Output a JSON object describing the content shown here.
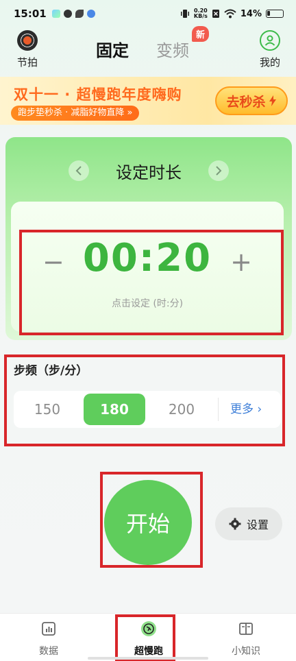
{
  "status_bar": {
    "time": "15:01",
    "net_speed_value": "0.20",
    "net_speed_unit": "KB/s",
    "battery": "14%"
  },
  "top_nav": {
    "left_label": "节拍",
    "tabs": [
      {
        "label": "固定"
      },
      {
        "label": "变频"
      }
    ],
    "new_badge": "新",
    "right_label": "我的"
  },
  "banner": {
    "title": "双十一 · 超慢跑年度嗨购",
    "subtitle": "跑步垫秒杀 · 减脂好物直降 »",
    "button_label": "去秒杀"
  },
  "timer": {
    "title": "设定时长",
    "value": "00:20",
    "hint": "点击设定 (时:分)"
  },
  "cadence": {
    "title": "步频（步/分）",
    "options": [
      "150",
      "180",
      "200"
    ],
    "selected": "180",
    "more_label": "更多"
  },
  "actions": {
    "start_label": "开始",
    "settings_label": "设置"
  },
  "bottom_nav": {
    "items": [
      {
        "label": "数据"
      },
      {
        "label": "超慢跑"
      },
      {
        "label": "小知识"
      }
    ]
  },
  "colors": {
    "accent_green": "#5fcd5c",
    "timer_green": "#3db53f",
    "highlight_red": "#d8262a",
    "link_blue": "#3e7fd8"
  }
}
